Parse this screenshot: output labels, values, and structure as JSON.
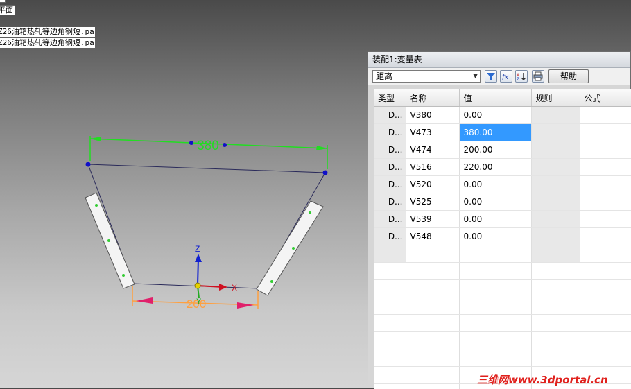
{
  "top_tag": "平面",
  "part_files": [
    "Z26油箱热轧等边角钢短.pa",
    "Z26油箱热轧等边角钢短.pa"
  ],
  "dimensions": {
    "top": "380",
    "bottom": "200"
  },
  "axes": {
    "z": "Z",
    "x": "X",
    "y": "Y"
  },
  "colors": {
    "dimension_top": "#22dd22",
    "dimension_bottom": "#ffa040",
    "axis_z": "#1020d0",
    "axis_x": "#d01020",
    "selection": "#3399ff"
  },
  "var_table": {
    "title": "装配1:变量表",
    "filter_value": "距离",
    "help_label": "帮助",
    "columns": [
      "类型",
      "名称",
      "值",
      "规则",
      "公式"
    ],
    "rows": [
      {
        "type": "D...",
        "name": "V380",
        "value": "0.00",
        "rule": "",
        "formula": "",
        "selected": false
      },
      {
        "type": "D...",
        "name": "V473",
        "value": "380.00",
        "rule": "",
        "formula": "",
        "selected": true
      },
      {
        "type": "D...",
        "name": "V474",
        "value": "200.00",
        "rule": "",
        "formula": "",
        "selected": false
      },
      {
        "type": "D...",
        "name": "V516",
        "value": "220.00",
        "rule": "",
        "formula": "",
        "selected": false
      },
      {
        "type": "D...",
        "name": "V520",
        "value": "0.00",
        "rule": "",
        "formula": "",
        "selected": false
      },
      {
        "type": "D...",
        "name": "V525",
        "value": "0.00",
        "rule": "",
        "formula": "",
        "selected": false
      },
      {
        "type": "D...",
        "name": "V539",
        "value": "0.00",
        "rule": "",
        "formula": "",
        "selected": false
      },
      {
        "type": "D...",
        "name": "V548",
        "value": "0.00",
        "rule": "",
        "formula": "",
        "selected": false
      }
    ],
    "toolbar_icons": [
      "filter-icon",
      "formula-icon",
      "sort-icon",
      "print-icon"
    ]
  },
  "watermark": "三维网www.3dportal.cn"
}
